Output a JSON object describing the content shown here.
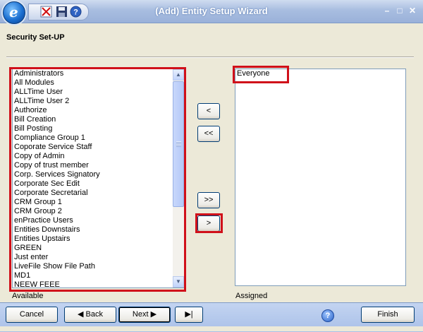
{
  "window": {
    "title": "(Add) Entity Setup Wizard"
  },
  "icons": {
    "logo": "app-logo-e",
    "toolbar": [
      "cross-out-icon",
      "save-disk-icon",
      "help-icon"
    ]
  },
  "section": {
    "title": "Security Set-UP"
  },
  "available": {
    "caption": "Available",
    "items": [
      "Administrators",
      "All Modules",
      "ALLTime User",
      "ALLTime User 2",
      "Authorize",
      "Bill Creation",
      "Bill Posting",
      "Compliance Group 1",
      "Coporate Service Staff",
      "Copy of Admin",
      "Copy of trust member",
      "Corp. Services Signatory",
      "Corporate Sec Edit",
      "Corporate Secretarial",
      "CRM Group 1",
      "CRM Group 2",
      "enPractice Users",
      "Entities Downstairs",
      "Entities Upstairs",
      "GREEN",
      "Just enter",
      "LiveFile Show File Path",
      "MD1",
      "NEEW FEEE"
    ]
  },
  "assigned": {
    "caption": "Assigned",
    "items": [
      "Everyone"
    ]
  },
  "move_buttons": {
    "remove_one": "<",
    "remove_all": "<<",
    "add_all": ">>",
    "add_one": ">"
  },
  "footer": {
    "cancel": "Cancel",
    "back": "Back",
    "next": "Next",
    "finish": "Finish"
  },
  "colors": {
    "highlight": "#d0101a",
    "titlebar": "#9ab1d9"
  }
}
